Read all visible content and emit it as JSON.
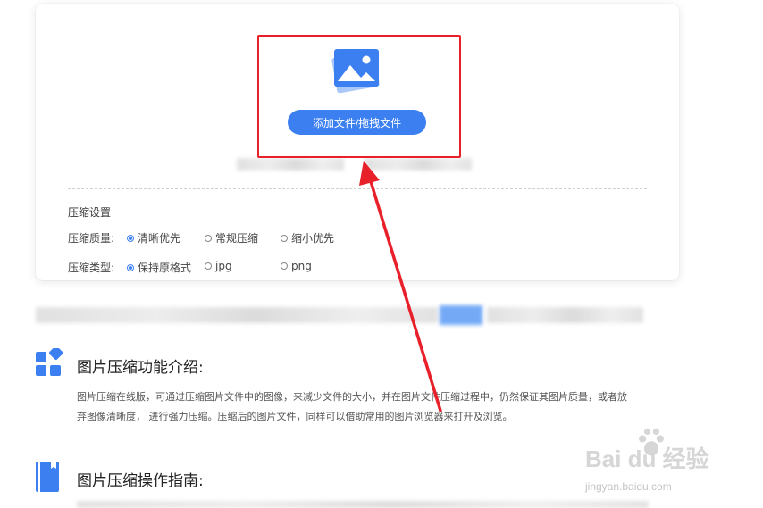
{
  "upload": {
    "button_label": "添加文件/拖拽文件"
  },
  "settings": {
    "title": "压缩设置",
    "quality": {
      "label": "压缩质量:",
      "options": [
        "清晰优先",
        "常规压缩",
        "缩小优先"
      ],
      "selected": "清晰优先"
    },
    "type": {
      "label": "压缩类型:",
      "options": [
        "保持原格式",
        "jpg",
        "png"
      ],
      "selected": "保持原格式"
    }
  },
  "intro": {
    "title": "图片压缩功能介绍:",
    "line1": "图片压缩在线版，可通过压缩图片文件中的图像，来减少文件的大小，并在图片文件压缩过程中，仍然保证其图片质量，或者放",
    "line2": "弃图像清晰度，  进行强力压缩。压缩后的图片文件，同样可以借助常用的图片浏览器来打开及浏览。"
  },
  "guide": {
    "title": "图片压缩操作指南:"
  },
  "watermark": {
    "brand": "Bai du 经验",
    "url": "jingyan.baidu.com"
  },
  "colors": {
    "accent": "#3b7ff0",
    "annotation_red": "#e8202a"
  }
}
